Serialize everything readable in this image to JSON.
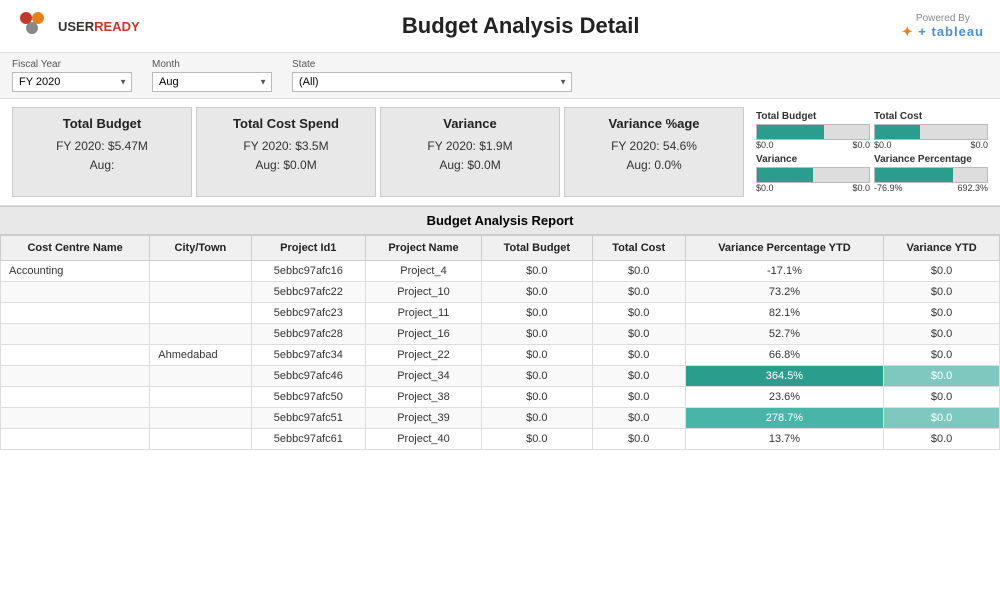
{
  "header": {
    "logo_text_user": "USER",
    "logo_text_ready": "READY",
    "title": "Budget Analysis Detail",
    "powered_by": "Powered By",
    "tableau_label": "+ tableau"
  },
  "filters": {
    "fiscal_year_label": "Fiscal Year",
    "fiscal_year_value": "FY 2020",
    "month_label": "Month",
    "month_value": "Aug",
    "state_label": "State",
    "state_value": "(All)"
  },
  "kpi": {
    "cards": [
      {
        "title": "Total Budget",
        "line1": "FY 2020: $5.47M",
        "line2": "Aug:"
      },
      {
        "title": "Total Cost Spend",
        "line1": "FY 2020:  $3.5M",
        "line2": "Aug:  $0.0M"
      },
      {
        "title": "Variance",
        "line1": "FY 2020:  $1.9M",
        "line2": "Aug:  $0.0M"
      },
      {
        "title": "Variance %age",
        "line1": "FY 2020: 54.6%",
        "line2": "Aug:  0.0%"
      }
    ]
  },
  "mini_charts": [
    {
      "title": "Total Budget",
      "min_label": "$0.0",
      "max_label": "$0.0",
      "bar_width_pct": 60
    },
    {
      "title": "Total Cost",
      "min_label": "$0.0",
      "max_label": "$0.0",
      "bar_width_pct": 40
    },
    {
      "title": "Variance",
      "min_label": "$0.0",
      "max_label": "$0.0",
      "bar_width_pct": 50
    },
    {
      "title": "Variance Percentage",
      "min_label": "-76.9%",
      "max_label": "692.3%",
      "bar_width_pct": 70
    }
  ],
  "table": {
    "section_title": "Budget Analysis Report",
    "headers": [
      "Cost Centre Name",
      "City/Town",
      "Project Id1",
      "Project Name",
      "Total Budget",
      "Total Cost",
      "Variance Percentage YTD",
      "Variance YTD"
    ],
    "rows": [
      {
        "cost_centre": "Accounting",
        "city": "",
        "project_id": "5ebbc97afc16",
        "project_name": "Project_4",
        "total_budget": "$0.0",
        "total_cost": "$0.0",
        "variance_pct": "-17.1%",
        "variance_ytd": "$0.0",
        "variance_style": ""
      },
      {
        "cost_centre": "",
        "city": "",
        "project_id": "5ebbc97afc22",
        "project_name": "Project_10",
        "total_budget": "$0.0",
        "total_cost": "$0.0",
        "variance_pct": "73.2%",
        "variance_ytd": "$0.0",
        "variance_style": ""
      },
      {
        "cost_centre": "",
        "city": "",
        "project_id": "5ebbc97afc23",
        "project_name": "Project_11",
        "total_budget": "$0.0",
        "total_cost": "$0.0",
        "variance_pct": "82.1%",
        "variance_ytd": "$0.0",
        "variance_style": ""
      },
      {
        "cost_centre": "",
        "city": "",
        "project_id": "5ebbc97afc28",
        "project_name": "Project_16",
        "total_budget": "$0.0",
        "total_cost": "$0.0",
        "variance_pct": "52.7%",
        "variance_ytd": "$0.0",
        "variance_style": ""
      },
      {
        "cost_centre": "",
        "city": "Ahmedabad",
        "project_id": "5ebbc97afc34",
        "project_name": "Project_22",
        "total_budget": "$0.0",
        "total_cost": "$0.0",
        "variance_pct": "66.8%",
        "variance_ytd": "$0.0",
        "variance_style": ""
      },
      {
        "cost_centre": "",
        "city": "",
        "project_id": "5ebbc97afc46",
        "project_name": "Project_34",
        "total_budget": "$0.0",
        "total_cost": "$0.0",
        "variance_pct": "364.5%",
        "variance_ytd": "$0.0",
        "variance_style": "teal"
      },
      {
        "cost_centre": "",
        "city": "",
        "project_id": "5ebbc97afc50",
        "project_name": "Project_38",
        "total_budget": "$0.0",
        "total_cost": "$0.0",
        "variance_pct": "23.6%",
        "variance_ytd": "$0.0",
        "variance_style": ""
      },
      {
        "cost_centre": "",
        "city": "",
        "project_id": "5ebbc97afc51",
        "project_name": "Project_39",
        "total_budget": "$0.0",
        "total_cost": "$0.0",
        "variance_pct": "278.7%",
        "variance_ytd": "$0.0",
        "variance_style": "medium-teal"
      },
      {
        "cost_centre": "",
        "city": "",
        "project_id": "5ebbc97afc61",
        "project_name": "Project_40",
        "total_budget": "$0.0",
        "total_cost": "$0.0",
        "variance_pct": "13.7%",
        "variance_ytd": "$0.0",
        "variance_style": ""
      }
    ]
  }
}
